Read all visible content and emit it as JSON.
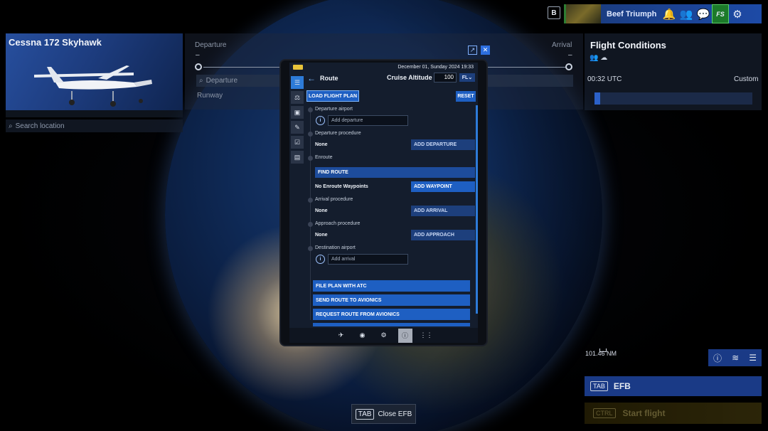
{
  "topbar": {
    "kbd_b": "B",
    "username": "Beef Triumph",
    "icons": [
      "bell-icon",
      "users-icon",
      "chat-icon",
      "fs-marketplace-icon",
      "gear-icon"
    ],
    "fs_label": "FS"
  },
  "aircraft": {
    "title": "Cessna 172 Skyhawk"
  },
  "search": {
    "placeholder": "Search location"
  },
  "flight": {
    "departure_label": "Departure",
    "arrival_label": "Arrival",
    "departure_value": "–",
    "arrival_value": "–",
    "departure_input_placeholder": "Departure",
    "runway_label": "Runway"
  },
  "conditions": {
    "title": "Flight Conditions",
    "time": "00:32 UTC",
    "mode": "Custom"
  },
  "map": {
    "scale": "101.46 NM"
  },
  "efb_bar": {
    "key": "TAB",
    "label": "EFB"
  },
  "start_bar": {
    "key": "CTRL",
    "label": "Start flight"
  },
  "close_efb": {
    "key": "TAB",
    "label": "Close EFB"
  },
  "tablet": {
    "datetime": "December 01, Sunday 2024 19:33",
    "header": {
      "title": "Route",
      "cruise_label": "Cruise Altitude",
      "cruise_value": "100",
      "unit": "FL"
    },
    "load_button": "LOAD FLIGHT PLAN",
    "reset_button": "RESET",
    "sections": {
      "departure_airport": "Departure airport",
      "add_departure_placeholder": "Add departure",
      "departure_procedure": "Departure procedure",
      "departure_procedure_value": "None",
      "add_departure_button": "ADD DEPARTURE",
      "enroute": "Enroute",
      "find_route": "FIND ROUTE",
      "enroute_value": "No Enroute Waypoints",
      "add_waypoint": "ADD WAYPOINT",
      "arrival_procedure": "Arrival procedure",
      "arrival_value": "None",
      "add_arrival_button": "ADD ARRIVAL",
      "approach_procedure": "Approach procedure",
      "approach_value": "None",
      "add_approach_button": "ADD APPROACH",
      "destination_airport": "Destination airport",
      "add_arrival_placeholder": "Add arrival"
    },
    "actions": [
      "FILE PLAN WITH ATC",
      "SEND ROUTE TO AVIONICS",
      "REQUEST ROUTE FROM AVIONICS"
    ],
    "nav": [
      "airplane-icon",
      "atc-icon",
      "settings-icon",
      "info-icon",
      "apps-icon"
    ]
  },
  "colors": {
    "accent": "#1e5fc2",
    "panel": "#141d2d",
    "bar": "#1a3a86",
    "active": "#1c7a2a"
  }
}
